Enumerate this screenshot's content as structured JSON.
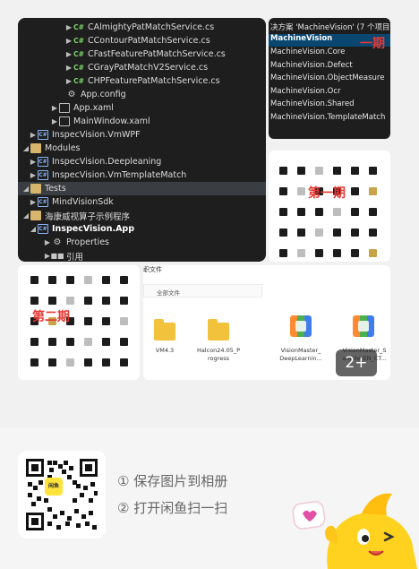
{
  "explorer": {
    "rows": [
      {
        "indent": 52,
        "arrow": "▶",
        "icon": "C#",
        "label": "CAlmightyPatMatchService.cs"
      },
      {
        "indent": 52,
        "arrow": "▶",
        "icon": "C#",
        "label": "CContourPatMatchService.cs"
      },
      {
        "indent": 52,
        "arrow": "▶",
        "icon": "C#",
        "label": "CFastFeaturePatMatchService.cs"
      },
      {
        "indent": 52,
        "arrow": "▶",
        "icon": "C#",
        "label": "CGrayPatMatchV2Service.cs"
      },
      {
        "indent": 52,
        "arrow": "▶",
        "icon": "C#",
        "label": "CHPFeaturePatMatchService.cs"
      },
      {
        "indent": 44,
        "arrow": "",
        "icon": "gear",
        "label": "App.config"
      },
      {
        "indent": 36,
        "arrow": "▶",
        "icon": "file",
        "label": "App.xaml"
      },
      {
        "indent": 36,
        "arrow": "▶",
        "icon": "file",
        "label": "MainWindow.xaml"
      },
      {
        "indent": 12,
        "arrow": "▶",
        "icon": "proj",
        "label": "InspecVision.VmWPF"
      },
      {
        "indent": 4,
        "arrow": "◢",
        "icon": "folder",
        "label": "Modules"
      },
      {
        "indent": 12,
        "arrow": "▶",
        "icon": "proj",
        "label": "InspecVision.Deepleaning"
      },
      {
        "indent": 12,
        "arrow": "▶",
        "icon": "proj",
        "label": "InspecVision.VmTemplateMatch"
      },
      {
        "indent": 4,
        "arrow": "◢",
        "icon": "folder",
        "label": "Tests"
      },
      {
        "indent": 12,
        "arrow": "▶",
        "icon": "proj",
        "label": "MindVisionSdk"
      },
      {
        "indent": 4,
        "arrow": "◢",
        "icon": "folder",
        "label": "海康威视算子示例程序"
      },
      {
        "indent": 12,
        "arrow": "◢",
        "icon": "proj",
        "label": "InspecVision.App",
        "bold": true
      },
      {
        "indent": 28,
        "arrow": "▶",
        "icon": "gear",
        "label": "Properties"
      },
      {
        "indent": 28,
        "arrow": "▶",
        "icon": "ref",
        "label": "引用"
      }
    ]
  },
  "solution": {
    "title": "决方案 'MachineVision' (7 个项目,",
    "selected": "MachineVision",
    "items": [
      "MachineVision.Core",
      "MachineVision.Defect",
      "MachineVision.ObjectMeasure",
      "MachineVision.Ocr",
      "MachineVision.Shared",
      "MachineVision.TemplateMatch"
    ],
    "note": "一期"
  },
  "thumb_notes": {
    "first": "第一期",
    "second": "第二期"
  },
  "files": {
    "header": "职文件",
    "crumb": "全部文件",
    "items": [
      {
        "type": "folder",
        "label": "VM4.3"
      },
      {
        "type": "folder",
        "label": "Halcon24.05_P rogress"
      },
      {
        "type": "app",
        "label": "VisionMaster_ DeepLearnin..."
      },
      {
        "type": "app",
        "label": "VisionMaster_S ample_EN_CT..."
      }
    ],
    "more": "2+"
  },
  "bottom": {
    "qr_logo": "闲鱼",
    "step1": "① 保存图片到相册",
    "step2": "② 打开闲鱼扫一扫"
  },
  "colors": {
    "explorer_bg": "#1e1e1e",
    "selection": "#094771",
    "note_red": "#e53935",
    "folder_yellow": "#f3c23d",
    "mascot_yellow": "#ffd21f"
  }
}
